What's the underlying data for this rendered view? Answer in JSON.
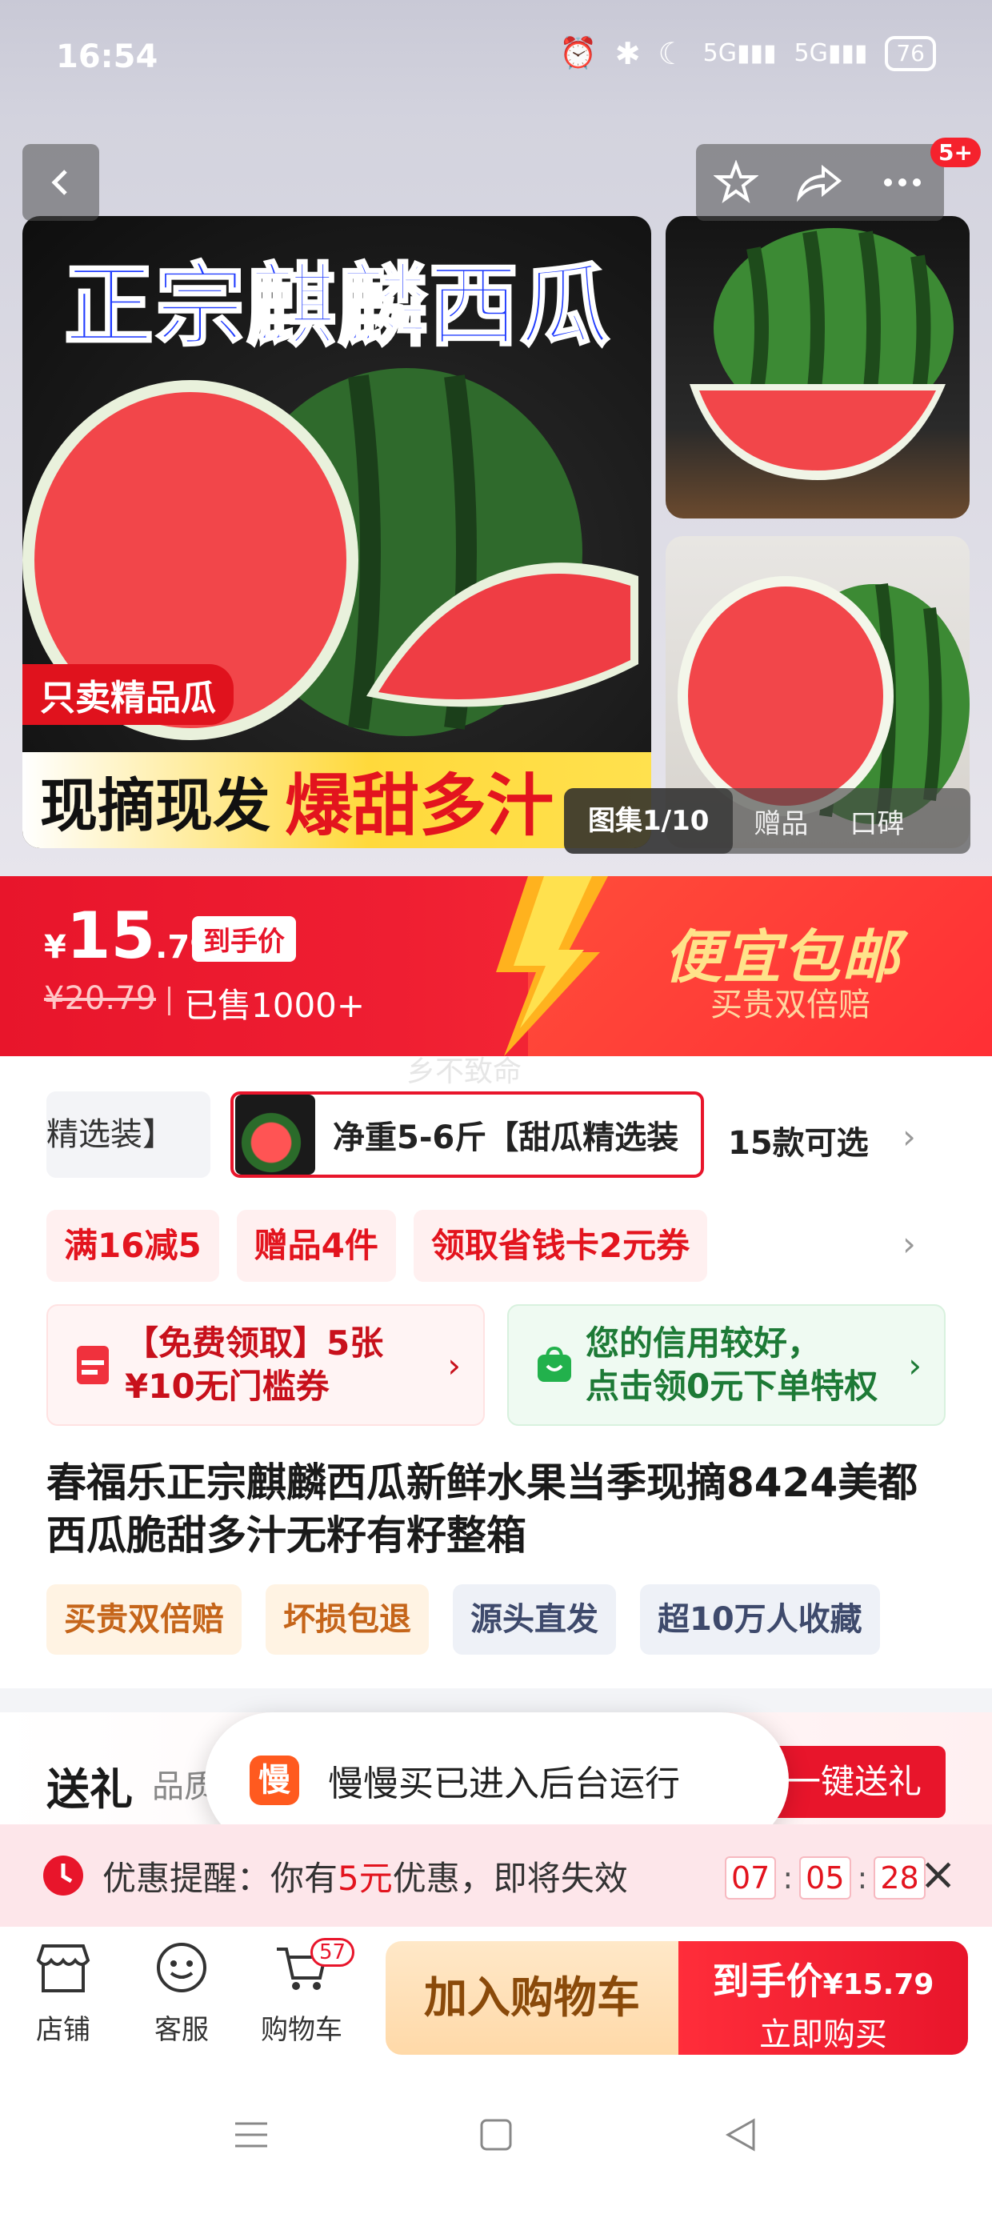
{
  "status_bar": {
    "time": "16:54",
    "icons": [
      "alarm-icon",
      "bluetooth-icon",
      "moon-icon",
      "5g-signal-icon",
      "5g-signal-icon"
    ],
    "battery": "76"
  },
  "nav": {
    "cart_badge": "5+"
  },
  "hero": {
    "main_title": "正宗麒麟西瓜",
    "tag_only": "只卖精品瓜",
    "tag_bottom_black": "现摘现发",
    "tag_bottom_red": "爆甜多汁",
    "gallery_current": "图集1/10",
    "gallery_items": [
      "赠品",
      "口碑"
    ]
  },
  "price": {
    "currency": "¥",
    "integer": "15",
    "decimal": ".79",
    "label": "到手价",
    "original": "¥20.79",
    "sold": "已售1000+",
    "slogan": "便宜包邮",
    "slogan_sub": "买贵双倍赔"
  },
  "watermark": "乡不致命",
  "styles": {
    "prev_label": "精选装】",
    "current_label": "净重5-6斤【甜瓜精选装",
    "count": "15款可选"
  },
  "promos": [
    "满16减5",
    "赠品4件",
    "领取省钱卡2元券"
  ],
  "coupon_card": {
    "line1": "【免费领取】5张",
    "line2": "¥10无门槛券"
  },
  "credit_card": {
    "line1": "您的信用较好，",
    "line2": "点击领0元下单特权"
  },
  "product_title": "春福乐正宗麒麟西瓜新鲜水果当季现摘8424美都西瓜脆甜多汁无籽有籽整箱",
  "tags": [
    "买贵双倍赔",
    "坏损包退",
    "源头直发",
    "超10万人收藏"
  ],
  "gift": {
    "label": "送礼",
    "sub": "品质",
    "button": "一键送礼"
  },
  "toast": {
    "icon_char": "慢",
    "text": "慢慢买已进入后台运行"
  },
  "reminder": {
    "prefix": "优惠提醒：你有",
    "highlight": "5元",
    "suffix": "优惠，即将失效",
    "hh": "07",
    "mm": "05",
    "ss": "28"
  },
  "bottom_bar": {
    "shop": "店铺",
    "service": "客服",
    "cart": "购物车",
    "cart_count": "57",
    "add_to_cart": "加入购物车",
    "buy_line1_label": "到手价",
    "buy_line1_price": "¥15.79",
    "buy_line2": "立即购买"
  },
  "colors": {
    "primary_red": "#e8152b",
    "gold": "#ffe28a",
    "credit_green": "#1d7a36"
  }
}
